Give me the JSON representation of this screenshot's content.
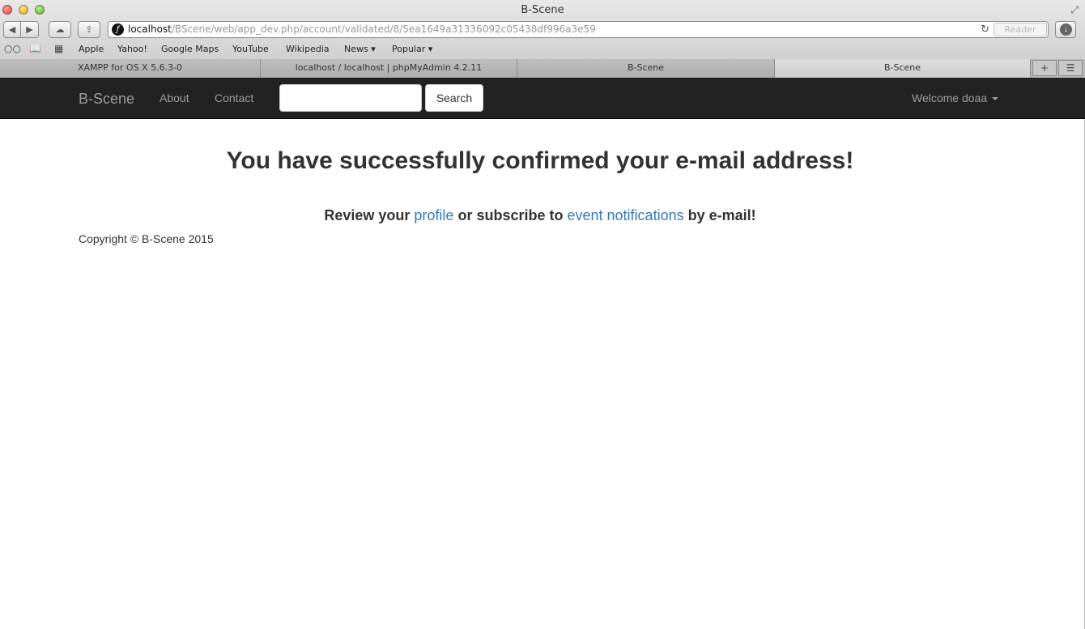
{
  "browser": {
    "window_title": "B-Scene",
    "url_host": "localhost",
    "url_path": "/BScene/web/app_dev.php/account/validated/8/5ea1649a31336092c05438df996a3e59",
    "reader_label": "Reader",
    "bookmarks": [
      "Apple",
      "Yahoo!",
      "Google Maps",
      "YouTube",
      "Wikipedia",
      "News ▾",
      "Popular ▾"
    ],
    "tabs": [
      "XAMPP for OS X 5.6.3-0",
      "localhost / localhost | phpMyAdmin 4.2.11",
      "B-Scene",
      "B-Scene"
    ]
  },
  "navbar": {
    "brand": "B-Scene",
    "links": [
      "About",
      "Contact"
    ],
    "search_value": "",
    "search_button": "Search",
    "user_menu": "Welcome doaa"
  },
  "main": {
    "heading": "You have successfully confirmed your e-mail address!",
    "lead_prefix": "Review your",
    "profile_link": "profile",
    "lead_middle": "or subscribe to",
    "notifications_link": "event notifications",
    "lead_suffix": "by e-mail!"
  },
  "footer": {
    "copyright": "Copyright © B-Scene 2015"
  },
  "colors": {
    "navbar_bg": "#222222",
    "link": "#337ab7",
    "text": "#333333"
  }
}
